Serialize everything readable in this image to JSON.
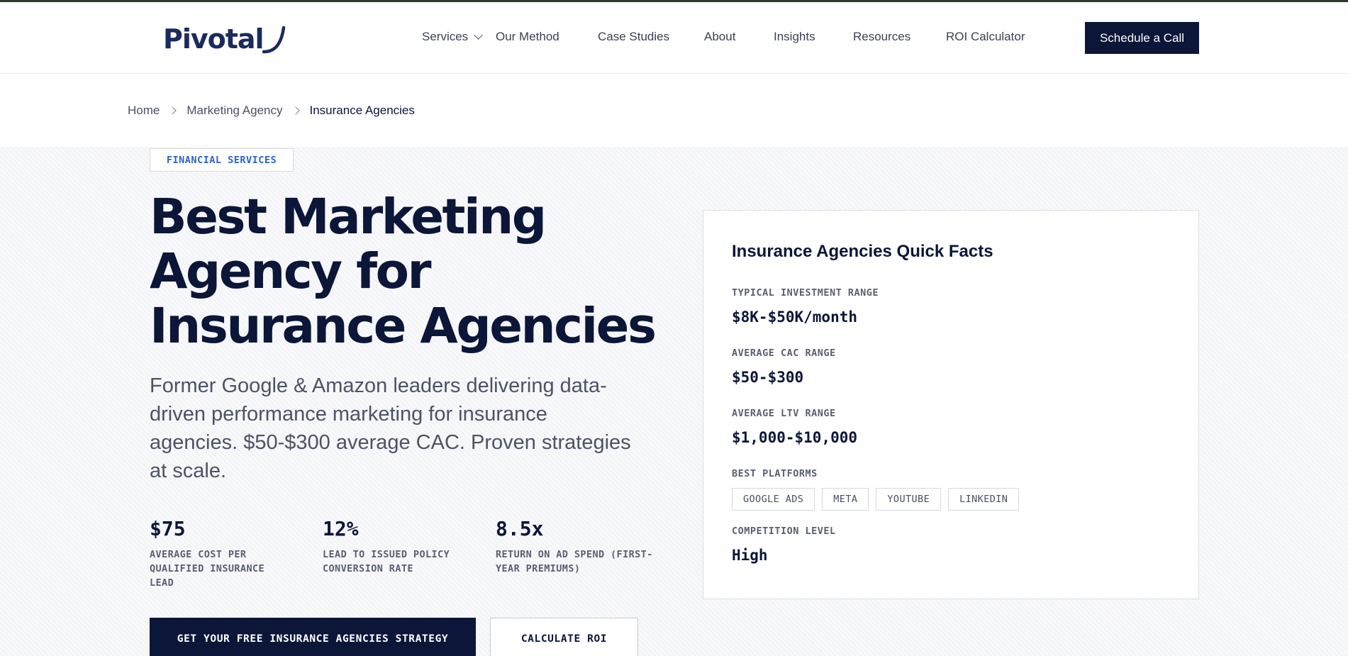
{
  "header": {
    "logo_text": "Pivotal",
    "nav": [
      {
        "label": "Services",
        "has_dropdown": true
      },
      {
        "label": "Our Method"
      },
      {
        "label": "Case Studies"
      },
      {
        "label": "About"
      },
      {
        "label": "Insights"
      },
      {
        "label": "Resources"
      },
      {
        "label": "ROI Calculator"
      }
    ],
    "cta_label": "Schedule a Call"
  },
  "breadcrumb": [
    "Home",
    "Marketing Agency",
    "Insurance Agencies"
  ],
  "hero": {
    "tag": "FINANCIAL SERVICES",
    "title": "Best Marketing Agency for Insurance Agencies",
    "lead": "Former Google & Amazon leaders delivering data-driven performance marketing for insurance agencies. $50-$300 average CAC. Proven strategies at scale.",
    "stats": [
      {
        "value": "$75",
        "label": "AVERAGE COST PER QUALIFIED INSURANCE LEAD"
      },
      {
        "value": "12%",
        "label": "LEAD TO ISSUED POLICY CONVERSION RATE"
      },
      {
        "value": "8.5x",
        "label": "RETURN ON AD SPEND (FIRST-YEAR PREMIUMS)"
      }
    ],
    "primary_button": "GET YOUR FREE INSURANCE AGENCIES STRATEGY",
    "secondary_button": "CALCULATE ROI"
  },
  "facts": {
    "title": "Insurance Agencies Quick Facts",
    "investment_label": "TYPICAL INVESTMENT RANGE",
    "investment_value": "$8K-$50K/month",
    "cac_label": "AVERAGE CAC RANGE",
    "cac_value": "$50-$300",
    "ltv_label": "AVERAGE LTV RANGE",
    "ltv_value": "$1,000-$10,000",
    "platforms_label": "BEST PLATFORMS",
    "platforms": [
      "GOOGLE ADS",
      "META",
      "YOUTUBE",
      "LINKEDIN"
    ],
    "competition_label": "COMPETITION LEVEL",
    "competition_value": "High"
  },
  "colors": {
    "navy": "#0b1638",
    "tag_blue": "#2d63c8",
    "hero_bg": "#f3f4f7"
  }
}
